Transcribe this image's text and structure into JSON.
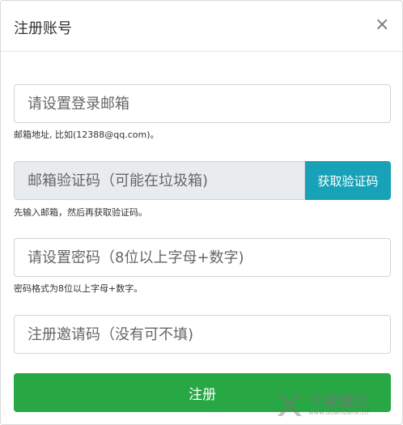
{
  "dialog": {
    "title": "注册账号",
    "close_symbol": "×"
  },
  "form": {
    "email": {
      "placeholder": "请设置登录邮箱",
      "help": "邮箱地址, 比如(12388@qq.com)。"
    },
    "code": {
      "placeholder": "邮箱验证码（可能在垃圾箱)",
      "button_label": "获取验证码",
      "help": "先输入邮箱，然后再获取验证码。"
    },
    "password": {
      "placeholder": "请设置密码（8位以上字母+数字)",
      "help": "密码格式为8位以上字母+数字。"
    },
    "invite": {
      "placeholder": "注册邀请码（没有可不填)"
    },
    "submit_label": "注册"
  },
  "watermark": {
    "name": "下载银行",
    "domain": "www.downbank.cn",
    "icon": "logo-mark"
  },
  "colors": {
    "primary_green": "#28a745",
    "info_teal": "#17a2b8",
    "disabled_bg": "#e9ecef"
  }
}
